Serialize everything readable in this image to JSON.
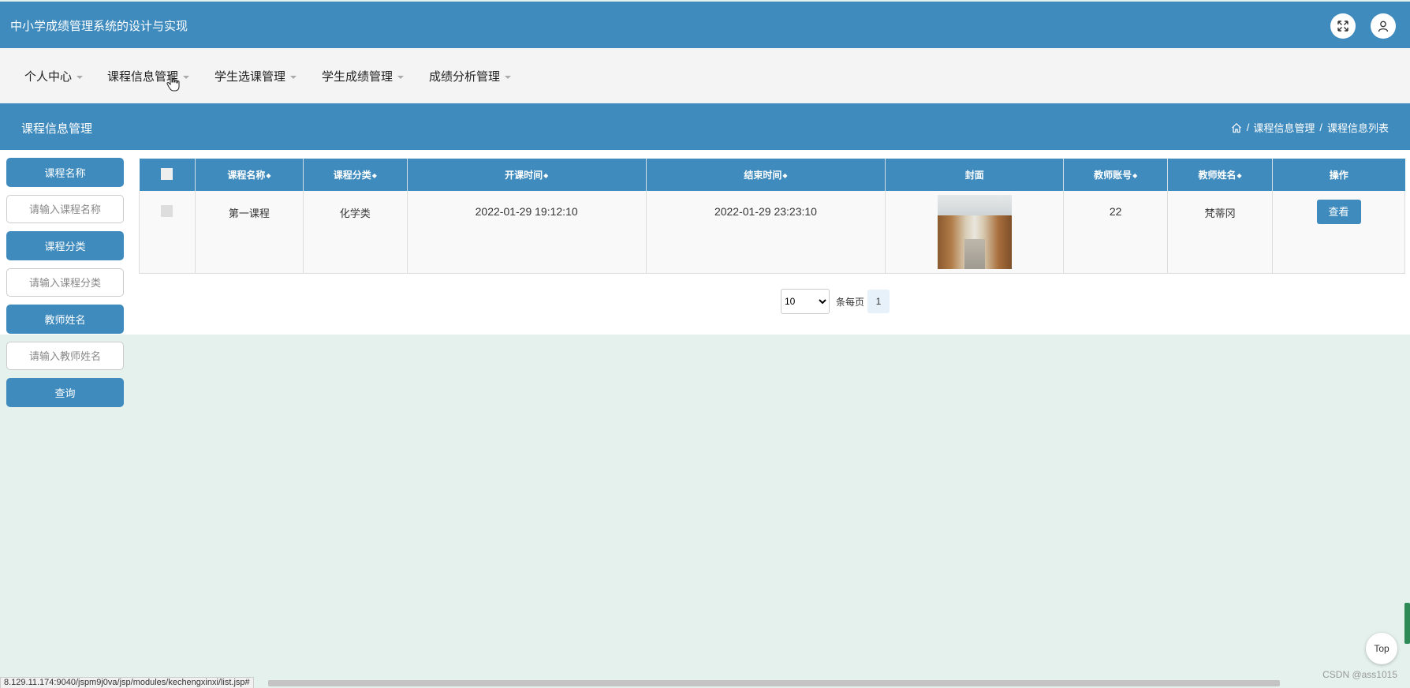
{
  "header": {
    "title": "中小学成绩管理系统的设计与实现"
  },
  "nav": {
    "items": [
      {
        "label": "个人中心"
      },
      {
        "label": "课程信息管理"
      },
      {
        "label": "学生选课管理"
      },
      {
        "label": "学生成绩管理"
      },
      {
        "label": "成绩分析管理"
      }
    ]
  },
  "banner": {
    "page_title": "课程信息管理",
    "breadcrumb": [
      "课程信息管理",
      "课程信息列表"
    ],
    "sep": "/"
  },
  "search": {
    "name_label": "课程名称",
    "name_placeholder": "请输入课程名称",
    "category_label": "课程分类",
    "category_placeholder": "请输入课程分类",
    "teacher_label": "教师姓名",
    "teacher_placeholder": "请输入教师姓名",
    "query_label": "查询"
  },
  "table": {
    "columns": [
      "课程名称",
      "课程分类",
      "开课时间",
      "结束时间",
      "封面",
      "教师账号",
      "教师姓名",
      "操作"
    ],
    "sort_glyph": "◆",
    "rows": [
      {
        "name": "第一课程",
        "category": "化学类",
        "start": "2022-01-29 19:12:10",
        "end": "2022-01-29 23:23:10",
        "teacher_account": "22",
        "teacher_name": "梵蒂冈",
        "action": "查看"
      }
    ]
  },
  "pagination": {
    "page_size": "10",
    "per_page_label": "条每页",
    "current_page": "1"
  },
  "footer": {
    "top_label": "Top",
    "status_url": "8.129.11.174:9040/jspm9j0va/jsp/modules/kechengxinxi/list.jsp#",
    "watermark": "CSDN @ass1015"
  },
  "colors": {
    "primary": "#3f8bbe",
    "page_bg": "#e5f1ed"
  }
}
